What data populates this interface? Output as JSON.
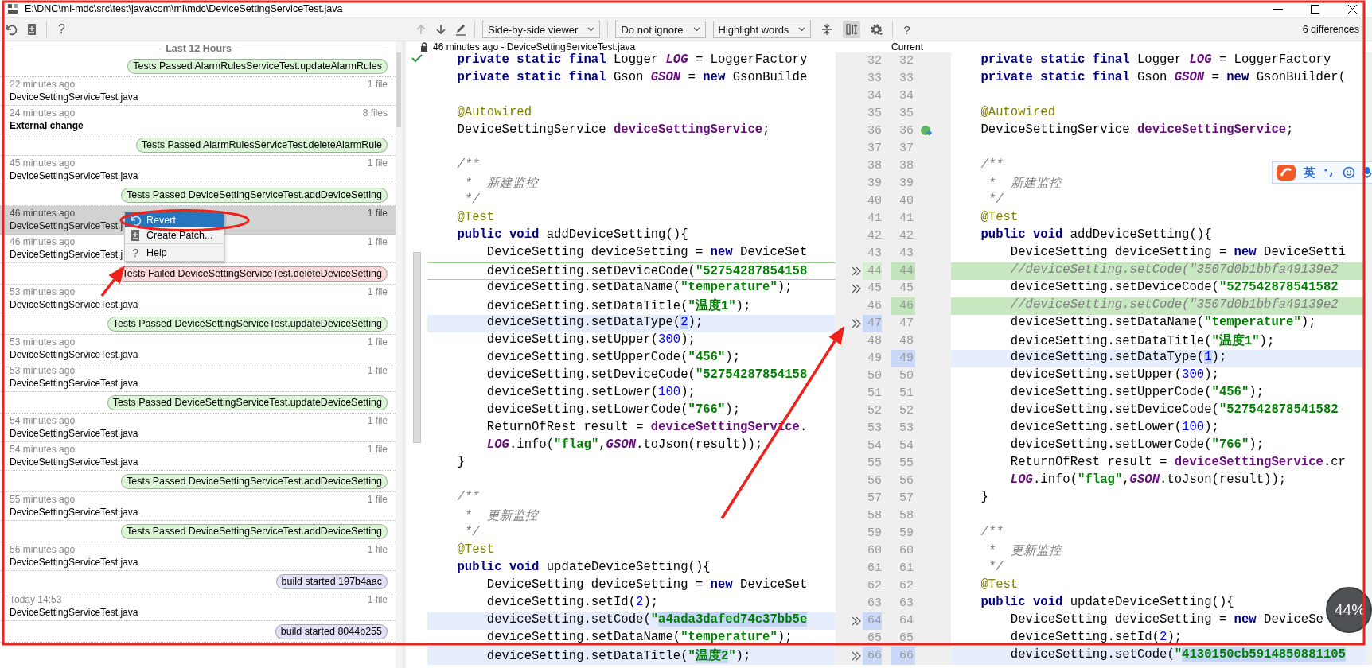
{
  "window": {
    "title": "E:\\DNC\\ml-mdc\\src\\test\\java\\com\\ml\\mdc\\DeviceSettingServiceTest.java"
  },
  "history_toolbar": {
    "buttons": [
      {
        "kind": "revert"
      },
      {
        "kind": "create-patch"
      }
    ],
    "help": "?"
  },
  "diff_toolbar": {
    "nav_buttons": [
      {
        "kind": "previous",
        "disabled": true
      },
      {
        "kind": "next",
        "disabled": false
      },
      {
        "kind": "edit",
        "disabled": false
      }
    ],
    "dropdowns": [
      {
        "label": "Side-by-side viewer"
      },
      {
        "label": "Do not ignore"
      },
      {
        "label": "Highlight words"
      }
    ],
    "tool_buttons": [
      {
        "kind": "collapse",
        "pressed": false
      },
      {
        "kind": "sync-scroll",
        "pressed": true
      },
      {
        "kind": "settings",
        "pressed": false
      }
    ],
    "help": "?",
    "differences": "6 differences"
  },
  "history": {
    "group": "Last 12 Hours",
    "items": [
      {
        "kind": "label",
        "text": "Tests Passed AlarmRulesServiceTest.updateAlarmRules",
        "color": "#dcf5d6",
        "selected": false
      },
      {
        "kind": "change",
        "time": "22 minutes ago",
        "files": "1 file",
        "name": "DeviceSettingServiceTest.java",
        "selected": false
      },
      {
        "kind": "external",
        "time": "24 minutes ago",
        "files": "8 files",
        "name": "External change",
        "selected": false
      },
      {
        "kind": "label",
        "text": "Tests Passed AlarmRulesServiceTest.deleteAlarmRule",
        "color": "#dcf5d6",
        "selected": false
      },
      {
        "kind": "change",
        "time": "45 minutes ago",
        "files": "1 file",
        "name": "DeviceSettingServiceTest.java",
        "selected": false
      },
      {
        "kind": "label",
        "text": "Tests Passed DeviceSettingServiceTest.addDeviceSetting",
        "color": "#dcf5d6",
        "selected": false
      },
      {
        "kind": "change",
        "time": "46 minutes ago",
        "files": "1 file",
        "name": "DeviceSettingServiceTest.j",
        "selected": true
      },
      {
        "kind": "change",
        "time": "46 minutes ago",
        "files": "1 file",
        "name": "DeviceSettingServiceTest.j",
        "selected": false
      },
      {
        "kind": "label",
        "text": "Tests Failed DeviceSettingServiceTest.deleteDeviceSetting",
        "color": "#f9d9d9",
        "selected": false
      },
      {
        "kind": "change",
        "time": "53 minutes ago",
        "files": "1 file",
        "name": "DeviceSettingServiceTest.java",
        "selected": false
      },
      {
        "kind": "label",
        "text": "Tests Passed DeviceSettingServiceTest.updateDeviceSetting",
        "color": "#dcf5d6",
        "selected": false
      },
      {
        "kind": "change",
        "time": "53 minutes ago",
        "files": "1 file",
        "name": "DeviceSettingServiceTest.java",
        "selected": false
      },
      {
        "kind": "change",
        "time": "53 minutes ago",
        "files": "1 file",
        "name": "DeviceSettingServiceTest.java",
        "selected": false
      },
      {
        "kind": "label",
        "text": "Tests Passed DeviceSettingServiceTest.updateDeviceSetting",
        "color": "#dcf5d6",
        "selected": false
      },
      {
        "kind": "change",
        "time": "54 minutes ago",
        "files": "1 file",
        "name": "DeviceSettingServiceTest.java",
        "selected": false
      },
      {
        "kind": "change",
        "time": "54 minutes ago",
        "files": "1 file",
        "name": "DeviceSettingServiceTest.java",
        "selected": false
      },
      {
        "kind": "label",
        "text": "Tests Passed DeviceSettingServiceTest.addDeviceSetting",
        "color": "#dcf5d6",
        "selected": false
      },
      {
        "kind": "change",
        "time": "55 minutes ago",
        "files": "1 file",
        "name": "DeviceSettingServiceTest.java",
        "selected": false
      },
      {
        "kind": "label",
        "text": "Tests Passed DeviceSettingServiceTest.addDeviceSetting",
        "color": "#dcf5d6",
        "selected": false
      },
      {
        "kind": "change",
        "time": "56 minutes ago",
        "files": "1 file",
        "name": "DeviceSettingServiceTest.java",
        "selected": false
      },
      {
        "kind": "label",
        "text": "build started 197b4aac",
        "color": "#e2e2f7",
        "selected": false
      },
      {
        "kind": "change",
        "time": "Today 14:53",
        "files": "1 file",
        "name": "DeviceSettingServiceTest.java",
        "selected": false
      },
      {
        "kind": "label",
        "text": "build started 8044b255",
        "color": "#e2e2f7",
        "selected": false
      }
    ],
    "context_menu": {
      "items": [
        {
          "kind": "revert",
          "label": "Revert",
          "selected": true
        },
        {
          "kind": "patch",
          "label": "Create Patch...",
          "selected": false
        },
        {
          "kind": "help",
          "icon": "?",
          "label": "Help",
          "selected": false
        }
      ]
    }
  },
  "diff": {
    "left_title": "46 minutes ago - DeviceSettingServiceTest.java",
    "read_only": true,
    "right_title": "Current",
    "in_sync": true,
    "left": {
      "lines": [
        {
          "number": "32",
          "arrow": false,
          "kind": "unchanged",
          "tokens": [
            {
              "kind": "kw",
              "text": "    private static final "
            },
            {
              "kind": "p",
              "text": "Logger "
            },
            {
              "kind": "st",
              "text": "LOG"
            },
            {
              "kind": "p",
              "text": " = LoggerFactory"
            }
          ]
        },
        {
          "number": "33",
          "arrow": false,
          "kind": "unchanged",
          "tokens": [
            {
              "kind": "kw",
              "text": "    private static final "
            },
            {
              "kind": "p",
              "text": "Gson "
            },
            {
              "kind": "st",
              "text": "GSON"
            },
            {
              "kind": "p",
              "text": " = "
            },
            {
              "kind": "kw",
              "text": "new "
            },
            {
              "kind": "p",
              "text": "GsonBuilde"
            }
          ]
        },
        {
          "number": "34",
          "arrow": false,
          "kind": "unchanged"
        },
        {
          "number": "35",
          "arrow": false,
          "kind": "unchanged",
          "tokens": [
            {
              "kind": "ann",
              "text": "    @Autowired"
            }
          ]
        },
        {
          "number": "36",
          "arrow": false,
          "kind": "unchanged",
          "tokens": [
            {
              "kind": "p",
              "text": "    DeviceSettingService "
            },
            {
              "kind": "fld",
              "text": "deviceSettingService"
            },
            {
              "kind": "p",
              "text": ";"
            }
          ]
        },
        {
          "number": "37",
          "arrow": false,
          "kind": "unchanged"
        },
        {
          "number": "38",
          "arrow": false,
          "kind": "unchanged",
          "tokens": [
            {
              "kind": "cmt",
              "text": "    /**"
            }
          ]
        },
        {
          "number": "39",
          "arrow": false,
          "kind": "unchanged",
          "tokens": [
            {
              "kind": "cmt",
              "text": "     *  新建监控"
            }
          ]
        },
        {
          "number": "40",
          "arrow": false,
          "kind": "unchanged",
          "tokens": [
            {
              "kind": "cmt",
              "text": "     */"
            }
          ]
        },
        {
          "number": "41",
          "arrow": false,
          "kind": "unchanged",
          "tokens": [
            {
              "kind": "ann",
              "text": "    @Test"
            }
          ]
        },
        {
          "number": "42",
          "arrow": false,
          "kind": "unchanged",
          "tokens": [
            {
              "kind": "kw",
              "text": "    public void "
            },
            {
              "kind": "p",
              "text": "addDeviceSetting(){"
            }
          ]
        },
        {
          "number": "43",
          "arrow": false,
          "kind": "unchanged",
          "tokens": [
            {
              "kind": "p",
              "text": "        DeviceSetting deviceSetting = "
            },
            {
              "kind": "kw",
              "text": "new "
            },
            {
              "kind": "p",
              "text": "DeviceSet"
            }
          ]
        },
        {
          "number": "44",
          "arrow": true,
          "kind": "insert-marks",
          "tokens": [
            {
              "kind": "p",
              "text": "        deviceSetting.setDeviceCode("
            },
            {
              "kind": "str",
              "text": "\"52754287854158"
            }
          ]
        },
        {
          "number": "45",
          "arrow": true,
          "kind": "unchanged",
          "tokens": [
            {
              "kind": "p",
              "text": "        deviceSetting.setDataName("
            },
            {
              "kind": "str",
              "text": "\"temperature\""
            },
            {
              "kind": "p",
              "text": ");"
            }
          ]
        },
        {
          "number": "46",
          "arrow": false,
          "kind": "unchanged",
          "tokens": [
            {
              "kind": "p",
              "text": "        deviceSetting.setDataTitle("
            },
            {
              "kind": "str",
              "text": "\"温度1\""
            },
            {
              "kind": "p",
              "text": ");"
            }
          ]
        },
        {
          "number": "47",
          "arrow": true,
          "kind": "modified",
          "tokens": [
            {
              "kind": "p",
              "text": "        deviceSetting.setDataType("
            },
            {
              "kind": "num-hl",
              "text": "2"
            },
            {
              "kind": "p",
              "text": ");"
            }
          ]
        },
        {
          "number": "48",
          "arrow": false,
          "kind": "unchanged",
          "tokens": [
            {
              "kind": "p",
              "text": "        deviceSetting.setUpper("
            },
            {
              "kind": "num",
              "text": "300"
            },
            {
              "kind": "p",
              "text": ");"
            }
          ]
        },
        {
          "number": "49",
          "arrow": false,
          "kind": "unchanged",
          "tokens": [
            {
              "kind": "p",
              "text": "        deviceSetting.setUpperCode("
            },
            {
              "kind": "str",
              "text": "\"456\""
            },
            {
              "kind": "p",
              "text": ");"
            }
          ]
        },
        {
          "number": "50",
          "arrow": false,
          "kind": "unchanged",
          "tokens": [
            {
              "kind": "p",
              "text": "        deviceSetting.setDeviceCode("
            },
            {
              "kind": "str",
              "text": "\"52754287854158"
            }
          ]
        },
        {
          "number": "51",
          "arrow": false,
          "kind": "unchanged",
          "tokens": [
            {
              "kind": "p",
              "text": "        deviceSetting.setLower("
            },
            {
              "kind": "num",
              "text": "100"
            },
            {
              "kind": "p",
              "text": ");"
            }
          ]
        },
        {
          "number": "52",
          "arrow": false,
          "kind": "unchanged",
          "tokens": [
            {
              "kind": "p",
              "text": "        deviceSetting.setLowerCode("
            },
            {
              "kind": "str",
              "text": "\"766\""
            },
            {
              "kind": "p",
              "text": ");"
            }
          ]
        },
        {
          "number": "53",
          "arrow": false,
          "kind": "unchanged",
          "tokens": [
            {
              "kind": "p",
              "text": "        ReturnOfRest result = "
            },
            {
              "kind": "fld",
              "text": "deviceSettingService"
            },
            {
              "kind": "p",
              "text": "."
            }
          ]
        },
        {
          "number": "54",
          "arrow": false,
          "kind": "unchanged",
          "tokens": [
            {
              "kind": "st",
              "text": "        LOG"
            },
            {
              "kind": "p",
              "text": ".info("
            },
            {
              "kind": "str",
              "text": "\"flag\""
            },
            {
              "kind": "p",
              "text": ","
            },
            {
              "kind": "st",
              "text": "GSON"
            },
            {
              "kind": "p",
              "text": ".toJson(result));"
            }
          ]
        },
        {
          "number": "55",
          "arrow": false,
          "kind": "unchanged",
          "tokens": [
            {
              "kind": "p",
              "text": "    }"
            }
          ]
        },
        {
          "number": "56",
          "arrow": false,
          "kind": "unchanged"
        },
        {
          "number": "57",
          "arrow": false,
          "kind": "unchanged",
          "tokens": [
            {
              "kind": "cmt",
              "text": "    /**"
            }
          ]
        },
        {
          "number": "58",
          "arrow": false,
          "kind": "unchanged",
          "tokens": [
            {
              "kind": "cmt",
              "text": "     *  更新监控"
            }
          ]
        },
        {
          "number": "59",
          "arrow": false,
          "kind": "unchanged",
          "tokens": [
            {
              "kind": "cmt",
              "text": "     */"
            }
          ]
        },
        {
          "number": "60",
          "arrow": false,
          "kind": "unchanged",
          "tokens": [
            {
              "kind": "ann",
              "text": "    @Test"
            }
          ]
        },
        {
          "number": "61",
          "arrow": false,
          "kind": "unchanged",
          "tokens": [
            {
              "kind": "kw",
              "text": "    public void "
            },
            {
              "kind": "p",
              "text": "updateDeviceSetting(){"
            }
          ]
        },
        {
          "number": "62",
          "arrow": false,
          "kind": "unchanged",
          "tokens": [
            {
              "kind": "p",
              "text": "        DeviceSetting deviceSetting = "
            },
            {
              "kind": "kw",
              "text": "new "
            },
            {
              "kind": "p",
              "text": "DeviceSet"
            }
          ]
        },
        {
          "number": "63",
          "arrow": false,
          "kind": "unchanged",
          "tokens": [
            {
              "kind": "p",
              "text": "        deviceSetting.setId("
            },
            {
              "kind": "num",
              "text": "2"
            },
            {
              "kind": "p",
              "text": ");"
            }
          ]
        },
        {
          "number": "64",
          "arrow": true,
          "kind": "modified",
          "tokens": [
            {
              "kind": "p",
              "text": "        deviceSetting.setCode("
            },
            {
              "kind": "str",
              "text": "\""
            },
            {
              "kind": "str-hl",
              "text": "a4ada3dafed74c37bb5e"
            }
          ]
        },
        {
          "number": "65",
          "arrow": false,
          "kind": "unchanged",
          "tokens": [
            {
              "kind": "p",
              "text": "        deviceSetting.setDataName("
            },
            {
              "kind": "str",
              "text": "\"temperature\""
            },
            {
              "kind": "p",
              "text": ");"
            }
          ]
        },
        {
          "number": "66",
          "arrow": true,
          "kind": "modified",
          "tokens": [
            {
              "kind": "p",
              "text": "        deviceSetting.setDataTitle("
            },
            {
              "kind": "str",
              "text": "\""
            },
            {
              "kind": "str-hl",
              "text": "温度2"
            },
            {
              "kind": "str",
              "text": "\""
            },
            {
              "kind": "p",
              "text": ");"
            }
          ]
        }
      ]
    },
    "right": {
      "lines": [
        {
          "number": "32",
          "icon": false,
          "kind": "unchanged",
          "tokens": [
            {
              "kind": "kw",
              "text": "    private static final "
            },
            {
              "kind": "p",
              "text": "Logger "
            },
            {
              "kind": "st",
              "text": "LOG"
            },
            {
              "kind": "p",
              "text": " = LoggerFactory"
            }
          ]
        },
        {
          "number": "33",
          "icon": false,
          "kind": "unchanged",
          "tokens": [
            {
              "kind": "kw",
              "text": "    private static final "
            },
            {
              "kind": "p",
              "text": "Gson "
            },
            {
              "kind": "st",
              "text": "GSON"
            },
            {
              "kind": "p",
              "text": " = "
            },
            {
              "kind": "kw",
              "text": "new "
            },
            {
              "kind": "p",
              "text": "GsonBuilder("
            }
          ]
        },
        {
          "number": "34",
          "icon": false,
          "kind": "unchanged"
        },
        {
          "number": "35",
          "icon": false,
          "kind": "unchanged",
          "tokens": [
            {
              "kind": "ann",
              "text": "    @Autowired"
            }
          ]
        },
        {
          "number": "36",
          "icon": true,
          "kind": "unchanged",
          "tokens": [
            {
              "kind": "p",
              "text": "    DeviceSettingService "
            },
            {
              "kind": "fld",
              "text": "deviceSettingService"
            },
            {
              "kind": "p",
              "text": ";"
            }
          ]
        },
        {
          "number": "37",
          "icon": false,
          "kind": "unchanged"
        },
        {
          "number": "38",
          "icon": false,
          "kind": "unchanged",
          "tokens": [
            {
              "kind": "cmt",
              "text": "    /**"
            }
          ]
        },
        {
          "number": "39",
          "icon": false,
          "kind": "unchanged",
          "tokens": [
            {
              "kind": "cmt",
              "text": "     *  新建监控"
            }
          ]
        },
        {
          "number": "40",
          "icon": false,
          "kind": "unchanged",
          "tokens": [
            {
              "kind": "cmt",
              "text": "     */"
            }
          ]
        },
        {
          "number": "41",
          "icon": false,
          "kind": "unchanged",
          "tokens": [
            {
              "kind": "ann",
              "text": "    @Test"
            }
          ]
        },
        {
          "number": "42",
          "icon": false,
          "kind": "unchanged",
          "tokens": [
            {
              "kind": "kw",
              "text": "    public void "
            },
            {
              "kind": "p",
              "text": "addDeviceSetting(){"
            }
          ]
        },
        {
          "number": "43",
          "icon": false,
          "kind": "unchanged",
          "tokens": [
            {
              "kind": "p",
              "text": "        DeviceSetting deviceSetting = "
            },
            {
              "kind": "kw",
              "text": "new "
            },
            {
              "kind": "p",
              "text": "DeviceSetti"
            }
          ]
        },
        {
          "number": "44",
          "icon": false,
          "kind": "inserted",
          "tokens": [
            {
              "kind": "cmt",
              "text": "        //deviceSetting.setCode(\"3507d0b1bbfa49139e2"
            }
          ]
        },
        {
          "number": "45",
          "icon": false,
          "kind": "unchanged",
          "tokens": [
            {
              "kind": "p",
              "text": "        deviceSetting.setDeviceCode("
            },
            {
              "kind": "str",
              "text": "\"527542878541582"
            }
          ]
        },
        {
          "number": "46",
          "icon": false,
          "kind": "inserted",
          "tokens": [
            {
              "kind": "cmt",
              "text": "        //deviceSetting.setCode(\"3507d0b1bbfa49139e2"
            }
          ]
        },
        {
          "number": "47",
          "icon": false,
          "kind": "unchanged",
          "tokens": [
            {
              "kind": "p",
              "text": "        deviceSetting.setDataName("
            },
            {
              "kind": "str",
              "text": "\"temperature\""
            },
            {
              "kind": "p",
              "text": ");"
            }
          ]
        },
        {
          "number": "48",
          "icon": false,
          "kind": "unchanged",
          "tokens": [
            {
              "kind": "p",
              "text": "        deviceSetting.setDataTitle("
            },
            {
              "kind": "str",
              "text": "\"温度1\""
            },
            {
              "kind": "p",
              "text": ");"
            }
          ]
        },
        {
          "number": "49",
          "icon": false,
          "kind": "modified",
          "tokens": [
            {
              "kind": "p",
              "text": "        deviceSetting.setDataType("
            },
            {
              "kind": "num-hl",
              "text": "1"
            },
            {
              "kind": "p",
              "text": ");"
            }
          ]
        },
        {
          "number": "50",
          "icon": false,
          "kind": "unchanged",
          "tokens": [
            {
              "kind": "p",
              "text": "        deviceSetting.setUpper("
            },
            {
              "kind": "num",
              "text": "300"
            },
            {
              "kind": "p",
              "text": ");"
            }
          ]
        },
        {
          "number": "51",
          "icon": false,
          "kind": "unchanged",
          "tokens": [
            {
              "kind": "p",
              "text": "        deviceSetting.setUpperCode("
            },
            {
              "kind": "str",
              "text": "\"456\""
            },
            {
              "kind": "p",
              "text": ");"
            }
          ]
        },
        {
          "number": "52",
          "icon": false,
          "kind": "unchanged",
          "tokens": [
            {
              "kind": "p",
              "text": "        deviceSetting.setDeviceCode("
            },
            {
              "kind": "str",
              "text": "\"527542878541582"
            }
          ]
        },
        {
          "number": "53",
          "icon": false,
          "kind": "unchanged",
          "tokens": [
            {
              "kind": "p",
              "text": "        deviceSetting.setLower("
            },
            {
              "kind": "num",
              "text": "100"
            },
            {
              "kind": "p",
              "text": ");"
            }
          ]
        },
        {
          "number": "54",
          "icon": false,
          "kind": "unchanged",
          "tokens": [
            {
              "kind": "p",
              "text": "        deviceSetting.setLowerCode("
            },
            {
              "kind": "str",
              "text": "\"766\""
            },
            {
              "kind": "p",
              "text": ");"
            }
          ]
        },
        {
          "number": "55",
          "icon": false,
          "kind": "unchanged",
          "tokens": [
            {
              "kind": "p",
              "text": "        ReturnOfRest result = "
            },
            {
              "kind": "fld",
              "text": "deviceSettingService"
            },
            {
              "kind": "p",
              "text": ".cr"
            }
          ]
        },
        {
          "number": "56",
          "icon": false,
          "kind": "unchanged",
          "tokens": [
            {
              "kind": "st",
              "text": "        LOG"
            },
            {
              "kind": "p",
              "text": ".info("
            },
            {
              "kind": "str",
              "text": "\"flag\""
            },
            {
              "kind": "p",
              "text": ","
            },
            {
              "kind": "st",
              "text": "GSON"
            },
            {
              "kind": "p",
              "text": ".toJson(result));"
            }
          ]
        },
        {
          "number": "57",
          "icon": false,
          "kind": "unchanged",
          "tokens": [
            {
              "kind": "p",
              "text": "    }"
            }
          ]
        },
        {
          "number": "58",
          "icon": false,
          "kind": "unchanged"
        },
        {
          "number": "59",
          "icon": false,
          "kind": "unchanged",
          "tokens": [
            {
              "kind": "cmt",
              "text": "    /**"
            }
          ]
        },
        {
          "number": "60",
          "icon": false,
          "kind": "unchanged",
          "tokens": [
            {
              "kind": "cmt",
              "text": "     *  更新监控"
            }
          ]
        },
        {
          "number": "61",
          "icon": false,
          "kind": "unchanged",
          "tokens": [
            {
              "kind": "cmt",
              "text": "     */"
            }
          ]
        },
        {
          "number": "62",
          "icon": false,
          "kind": "unchanged",
          "tokens": [
            {
              "kind": "ann",
              "text": "    @Test"
            }
          ]
        },
        {
          "number": "63",
          "icon": false,
          "kind": "unchanged",
          "tokens": [
            {
              "kind": "kw",
              "text": "    public void "
            },
            {
              "kind": "p",
              "text": "updateDeviceSetting(){"
            }
          ]
        },
        {
          "number": "64",
          "icon": false,
          "kind": "unchanged",
          "tokens": [
            {
              "kind": "p",
              "text": "        DeviceSetting deviceSetting = "
            },
            {
              "kind": "kw",
              "text": "new "
            },
            {
              "kind": "p",
              "text": "DeviceSe"
            }
          ]
        },
        {
          "number": "65",
          "icon": false,
          "kind": "unchanged",
          "tokens": [
            {
              "kind": "p",
              "text": "        deviceSetting.setId("
            },
            {
              "kind": "num",
              "text": "2"
            },
            {
              "kind": "p",
              "text": ");"
            }
          ]
        },
        {
          "number": "66",
          "icon": false,
          "kind": "modified",
          "tokens": [
            {
              "kind": "p",
              "text": "        deviceSetting.setCode("
            },
            {
              "kind": "str",
              "text": "\""
            },
            {
              "kind": "str-hl",
              "text": "4130150cb5914850881105"
            }
          ]
        }
      ]
    }
  },
  "ime_bar": {
    "mode": "英"
  },
  "progress_badge": {
    "text": "44%"
  },
  "markup": [
    {
      "kind": "frame"
    },
    {
      "kind": "ellipse"
    },
    {
      "kind": "arrow"
    },
    {
      "kind": "arrow"
    }
  ]
}
